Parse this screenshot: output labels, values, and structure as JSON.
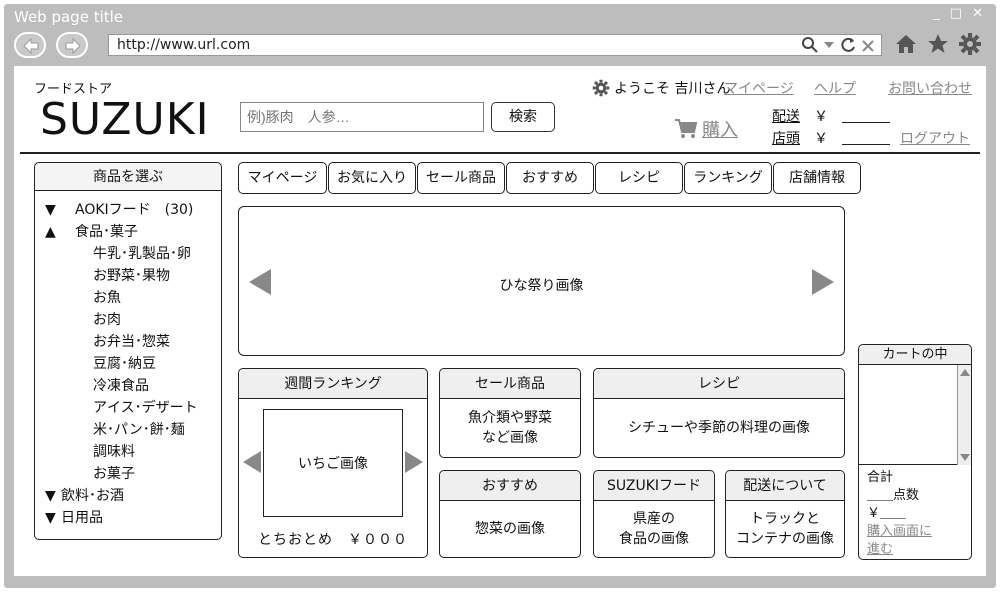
{
  "window": {
    "title": "Web page title",
    "controls": "_ □ ✕"
  },
  "browser": {
    "url": "http://www.url.com",
    "icons": [
      "back-icon",
      "forward-icon",
      "search-icon",
      "reload-icon",
      "close-icon",
      "home-icon",
      "star-icon",
      "gear-icon"
    ]
  },
  "header": {
    "store_sub": "フードストア",
    "logo": "SUZUKI",
    "search_placeholder": "例)豚肉　人参…",
    "search_button": "検索",
    "welcome": "ようこそ 吉川さん",
    "links": [
      "マイページ",
      "ヘルプ",
      "お問い合わせ"
    ],
    "buy": "購入",
    "shipping_label": "配送",
    "store_label": "店頭",
    "yen": "￥",
    "logout": "ログアウト"
  },
  "sidebar": {
    "title": "商品を選ぶ",
    "items": [
      {
        "tri": "▼",
        "label": "AOKIフード　(30)",
        "level": 0
      },
      {
        "tri": "▲",
        "label": "食品･菓子",
        "level": 0
      },
      {
        "tri": "",
        "label": "牛乳･乳製品･卵",
        "level": 1
      },
      {
        "tri": "",
        "label": "お野菜･果物",
        "level": 1
      },
      {
        "tri": "",
        "label": "お魚",
        "level": 1
      },
      {
        "tri": "",
        "label": "お肉",
        "level": 1
      },
      {
        "tri": "",
        "label": "お弁当･惣菜",
        "level": 1
      },
      {
        "tri": "",
        "label": "豆腐･納豆",
        "level": 1
      },
      {
        "tri": "",
        "label": "冷凍食品",
        "level": 1
      },
      {
        "tri": "",
        "label": "アイス･デザート",
        "level": 1
      },
      {
        "tri": "",
        "label": "米･パン･餅･麺",
        "level": 1
      },
      {
        "tri": "",
        "label": "調味料",
        "level": 1
      },
      {
        "tri": "",
        "label": "お菓子",
        "level": 1
      },
      {
        "tri": "▼",
        "label": "飲料･お酒",
        "level": 2
      },
      {
        "tri": "▼",
        "label": "日用品",
        "level": 2
      }
    ]
  },
  "tabs": [
    "マイページ",
    "お気に入り",
    "セール商品",
    "おすすめ",
    "レシピ",
    "ランキング",
    "店舗情報"
  ],
  "hero": {
    "label": "ひな祭り画像"
  },
  "ranking": {
    "title": "週間ランキング",
    "image": "いちご画像",
    "caption": "とちおとめ　￥０００"
  },
  "sale": {
    "title": "セール商品",
    "body": "魚介類や野菜\nなど画像"
  },
  "recipe": {
    "title": "レシピ",
    "body": "シチューや季節の料理の画像"
  },
  "recommend": {
    "title": "おすすめ",
    "body": "惣菜の画像"
  },
  "suzuki_food": {
    "title": "SUZUKIフード",
    "body": "県産の\n食品の画像"
  },
  "delivery": {
    "title": "配送について",
    "body": "トラックと\nコンテナの画像"
  },
  "cart": {
    "title": "カートの中",
    "total": "合計",
    "count": "＿＿点数",
    "price": "￥＿＿",
    "checkout": "購入画面に\n進む"
  }
}
